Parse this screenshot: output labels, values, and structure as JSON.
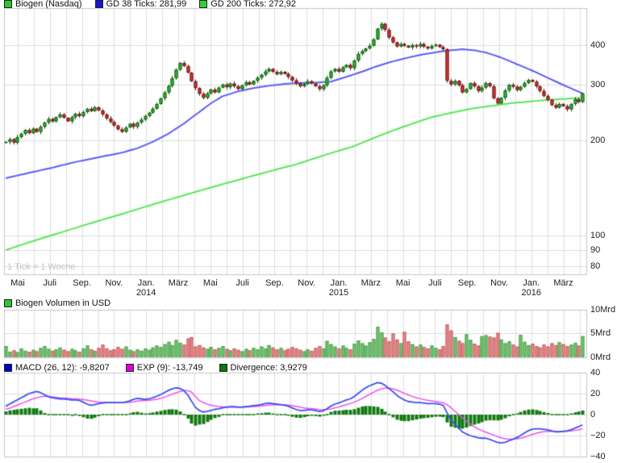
{
  "main": {
    "legend": [
      {
        "label": "Biogen (Nasdaq)",
        "color": "#2fc52f"
      },
      {
        "label": "GD 38 Ticks: 281,99",
        "color": "#1414dd"
      },
      {
        "label": "GD 200 Ticks: 272,92",
        "color": "#2fd42f"
      }
    ],
    "tick_note": "1 Tick = 1 Woche"
  },
  "volume_panel": {
    "legend": [
      {
        "label": "Biogen Volumen in USD",
        "color": "#2fc52f"
      }
    ]
  },
  "macd_panel": {
    "legend": [
      {
        "label": "MACD (26, 12): -9,8207",
        "color": "#0000cc"
      },
      {
        "label": "EXP (9): -13,749",
        "color": "#dd00dd"
      },
      {
        "label": "Divergence: 3,9279",
        "color": "#0a7a0a"
      }
    ]
  },
  "chart_data": [
    {
      "type": "candlestick",
      "title": "Biogen (Nasdaq)",
      "x_unit": "1 Tick = 1 Woche",
      "y_scale": "log",
      "ylim": [
        75.5,
        525
      ],
      "y_ticks": [
        400,
        300,
        200,
        100,
        90,
        80
      ],
      "x_ticks": [
        {
          "m": 0,
          "label": "Mai"
        },
        {
          "m": 2,
          "label": "Juli"
        },
        {
          "m": 4,
          "label": "Sep."
        },
        {
          "m": 6,
          "label": "Nov."
        },
        {
          "m": 8,
          "label": "Jan.",
          "year": "2014"
        },
        {
          "m": 10,
          "label": "März"
        },
        {
          "m": 12,
          "label": "Mai"
        },
        {
          "m": 14,
          "label": "Juli"
        },
        {
          "m": 16,
          "label": "Sep."
        },
        {
          "m": 18,
          "label": "Nov."
        },
        {
          "m": 20,
          "label": "Jan.",
          "year": "2015"
        },
        {
          "m": 22,
          "label": "März"
        },
        {
          "m": 24,
          "label": "Mai"
        },
        {
          "m": 26,
          "label": "Juli"
        },
        {
          "m": 28,
          "label": "Sep."
        },
        {
          "m": 30,
          "label": "Nov."
        },
        {
          "m": 32,
          "label": "Jan.",
          "year": "2016"
        },
        {
          "m": 34,
          "label": "März"
        }
      ],
      "months_total": 36,
      "closes": [
        198,
        202,
        197,
        205,
        210,
        216,
        211,
        218,
        213,
        221,
        228,
        234,
        230,
        237,
        242,
        236,
        230,
        237,
        243,
        239,
        246,
        252,
        248,
        255,
        249,
        242,
        235,
        229,
        223,
        217,
        213,
        220,
        226,
        221,
        228,
        233,
        239,
        245,
        252,
        261,
        272,
        284,
        298,
        315,
        335,
        352,
        344,
        328,
        308,
        293,
        281,
        273,
        282,
        290,
        284,
        294,
        301,
        295,
        303,
        297,
        291,
        299,
        306,
        301,
        309,
        316,
        323,
        331,
        337,
        330,
        324,
        330,
        325,
        318,
        310,
        303,
        297,
        302,
        308,
        303,
        297,
        291,
        299,
        316,
        331,
        337,
        330,
        341,
        347,
        339,
        358,
        376,
        384,
        391,
        399,
        418,
        452,
        468,
        448,
        424,
        409,
        397,
        404,
        399,
        394,
        401,
        397,
        404,
        396,
        391,
        398,
        402,
        395,
        389,
        309,
        301,
        309,
        299,
        284,
        291,
        304,
        297,
        287,
        294,
        304,
        297,
        272,
        262,
        273,
        288,
        300,
        296,
        289,
        296,
        304,
        311,
        307,
        297,
        287,
        277,
        269,
        259,
        254,
        261,
        257,
        251,
        261,
        270,
        265,
        282
      ],
      "gd38": {
        "name": "GD 38 Ticks",
        "current": "281,99",
        "color": "#5c5cf8",
        "points": [
          [
            0,
            152
          ],
          [
            6,
            158
          ],
          [
            12,
            164
          ],
          [
            18,
            171
          ],
          [
            24,
            177
          ],
          [
            30,
            183
          ],
          [
            34,
            189
          ],
          [
            38,
            198
          ],
          [
            42,
            210
          ],
          [
            46,
            226
          ],
          [
            50,
            246
          ],
          [
            53,
            262
          ],
          [
            56,
            276
          ],
          [
            60,
            286
          ],
          [
            64,
            293
          ],
          [
            68,
            298
          ],
          [
            72,
            302
          ],
          [
            76,
            304
          ],
          [
            80,
            305
          ],
          [
            84,
            307
          ],
          [
            88,
            318
          ],
          [
            92,
            330
          ],
          [
            96,
            344
          ],
          [
            100,
            356
          ],
          [
            104,
            366
          ],
          [
            108,
            375
          ],
          [
            112,
            382
          ],
          [
            115,
            386
          ],
          [
            118,
            389
          ],
          [
            121,
            386
          ],
          [
            124,
            380
          ],
          [
            128,
            366
          ],
          [
            132,
            349
          ],
          [
            136,
            333
          ],
          [
            140,
            316
          ],
          [
            144,
            300
          ],
          [
            147,
            289
          ],
          [
            149,
            282
          ]
        ]
      },
      "gd200": {
        "name": "GD 200 Ticks",
        "current": "272,92",
        "color": "#58e658",
        "points": [
          [
            0,
            90
          ],
          [
            15,
            103
          ],
          [
            30,
            117
          ],
          [
            45,
            133
          ],
          [
            60,
            150
          ],
          [
            75,
            168
          ],
          [
            90,
            192
          ],
          [
            100,
            215
          ],
          [
            110,
            237
          ],
          [
            120,
            252
          ],
          [
            130,
            262
          ],
          [
            140,
            269
          ],
          [
            149,
            273
          ]
        ]
      }
    },
    {
      "type": "bar",
      "title": "Biogen Volumen in USD",
      "ylim": [
        0,
        10
      ],
      "y_ticks": [
        {
          "label": "10Mrd",
          "v": 10
        },
        {
          "label": "5Mrd",
          "v": 5
        },
        {
          "label": "0Mrd",
          "v": 0
        }
      ],
      "values": [
        2.3,
        1.1,
        1.4,
        1.0,
        1.8,
        1.3,
        1.1,
        1.5,
        1.2,
        1.9,
        2.3,
        1.7,
        1.3,
        1.6,
        2.0,
        1.5,
        1.2,
        1.7,
        1.4,
        1.1,
        1.8,
        2.4,
        1.6,
        1.3,
        1.9,
        2.6,
        1.8,
        1.4,
        1.6,
        2.1,
        1.7,
        2.2,
        1.5,
        1.2,
        1.6,
        1.3,
        1.8,
        1.5,
        2.0,
        2.4,
        2.1,
        2.7,
        3.2,
        2.5,
        3.6,
        3.0,
        2.6,
        3.9,
        4.2,
        2.2,
        2.5,
        2.0,
        1.7,
        2.1,
        1.6,
        1.9,
        2.3,
        1.7,
        1.4,
        1.8,
        1.5,
        1.2,
        1.7,
        1.4,
        1.9,
        1.6,
        2.2,
        1.8,
        2.5,
        2.0,
        1.6,
        1.9,
        1.4,
        1.7,
        2.1,
        1.8,
        1.5,
        1.2,
        1.6,
        1.3,
        1.9,
        2.3,
        1.8,
        3.4,
        2.7,
        2.2,
        1.8,
        2.4,
        1.9,
        1.6,
        2.8,
        3.5,
        2.9,
        2.4,
        3.1,
        3.8,
        6.4,
        5.2,
        4.1,
        3.3,
        5.0,
        3.7,
        2.9,
        5.3,
        3.3,
        2.7,
        2.2,
        2.6,
        2.1,
        1.8,
        2.4,
        1.9,
        1.6,
        2.3,
        6.9,
        5.6,
        4.2,
        3.4,
        2.9,
        4.8,
        3.6,
        2.8,
        2.4,
        4.4,
        4.6,
        4.3,
        4.1,
        5.1,
        3.7,
        2.9,
        3.3,
        2.6,
        2.2,
        4.7,
        3.2,
        2.5,
        2.8,
        2.3,
        2.0,
        2.6,
        2.2,
        2.9,
        2.5,
        3.1,
        2.7,
        2.3,
        2.6,
        3.0,
        2.4,
        4.4
      ],
      "up_color": "#79c479",
      "down_color": "#e88c8c"
    },
    {
      "type": "line",
      "title": "MACD (26, 12)",
      "ylim": [
        -40,
        40
      ],
      "y_ticks": [
        40,
        20,
        0,
        -20,
        -40
      ],
      "series": [
        {
          "name": "MACD (26, 12)",
          "current": "-9,8207",
          "color": "#3c50f0",
          "values": [
            8,
            10,
            12,
            14,
            16,
            18,
            20,
            21,
            22,
            21,
            19,
            17,
            16,
            15.5,
            15,
            15,
            14.5,
            14,
            14,
            13.5,
            12,
            10,
            9,
            9.5,
            10.5,
            11,
            11.5,
            11.5,
            11.5,
            11.5,
            11.5,
            12,
            13,
            14.5,
            15.5,
            15,
            14.5,
            15,
            16,
            17.5,
            19,
            21,
            23,
            24.5,
            25.5,
            25,
            23,
            19,
            13,
            7,
            4,
            2.5,
            3,
            4,
            5,
            5.5,
            6.5,
            7,
            7.5,
            7.5,
            7,
            7,
            7.5,
            8,
            8.5,
            9,
            9.5,
            10.5,
            11,
            10.5,
            10,
            9.5,
            9,
            8,
            6.5,
            5,
            4,
            4,
            4.5,
            4.5,
            4,
            3,
            3.5,
            5.5,
            8,
            10,
            11,
            12.5,
            14,
            15,
            17,
            20,
            23,
            25.5,
            27.5,
            29,
            30.5,
            30,
            28,
            25,
            22,
            18.5,
            16,
            14,
            12.5,
            12,
            11.5,
            11.5,
            11,
            10.5,
            10.5,
            10.5,
            10,
            9,
            2,
            -5,
            -9,
            -13,
            -16.5,
            -18.5,
            -20,
            -21,
            -22,
            -22.5,
            -22.5,
            -23.5,
            -25,
            -26.5,
            -27,
            -26.5,
            -25,
            -23.5,
            -22,
            -20,
            -17.5,
            -15.5,
            -14,
            -13.5,
            -13.5,
            -14,
            -14.5,
            -15.5,
            -16.5,
            -16.5,
            -16,
            -15.5,
            -14.5,
            -13,
            -11.5,
            -9.8
          ]
        },
        {
          "name": "EXP (9)",
          "current": "-13,749",
          "color": "#ee50ee",
          "values": [
            5,
            6,
            7.5,
            9,
            10.5,
            12,
            13.5,
            15,
            16,
            17,
            17.5,
            17.5,
            17,
            16.5,
            16,
            15.8,
            15.5,
            15.2,
            15,
            14.8,
            14.5,
            13.8,
            13,
            12.5,
            12,
            11.8,
            11.7,
            11.6,
            11.5,
            11.5,
            11.5,
            11.6,
            11.8,
            12.2,
            12.8,
            13.2,
            13.4,
            13.6,
            14,
            14.6,
            15.5,
            16.6,
            18,
            19.4,
            20.8,
            22,
            22.8,
            22.8,
            21.5,
            17.5,
            13.5,
            11.5,
            10,
            9,
            8.3,
            7.7,
            7.5,
            7.4,
            7.4,
            7.5,
            7.4,
            7.3,
            7.3,
            7.4,
            7.6,
            7.9,
            8.2,
            8.6,
            9.1,
            9.4,
            9.5,
            9.5,
            9.4,
            9.1,
            8.6,
            7.9,
            7.1,
            6.4,
            6,
            5.7,
            5.4,
            4.9,
            4.6,
            4.8,
            5.4,
            6.3,
            7.2,
            8.3,
            9.4,
            10.5,
            11.8,
            13.4,
            15.3,
            17.3,
            19.3,
            21.2,
            23.1,
            24.5,
            25.2,
            25.2,
            24.6,
            23.4,
            21.9,
            20.3,
            18.7,
            17.4,
            16.2,
            15.3,
            14.4,
            13.6,
            13,
            12.5,
            12,
            11.4,
            9.5,
            6.6,
            3.5,
            0.2,
            -3.1,
            -6.2,
            -9,
            -11.4,
            -13.5,
            -15.3,
            -16.7,
            -18.1,
            -19.5,
            -20.9,
            -22.1,
            -23,
            -23.4,
            -23.4,
            -23.1,
            -22.5,
            -21.5,
            -20.3,
            -19,
            -17.9,
            -17,
            -16.4,
            -16,
            -15.9,
            -16,
            -16,
            -16,
            -15.9,
            -15.6,
            -15.1,
            -14.4,
            -13.7
          ]
        }
      ],
      "histogram": {
        "name": "Divergence",
        "current": "3,9279",
        "color": "#107a10",
        "rule": "macd_minus_exp"
      }
    }
  ]
}
